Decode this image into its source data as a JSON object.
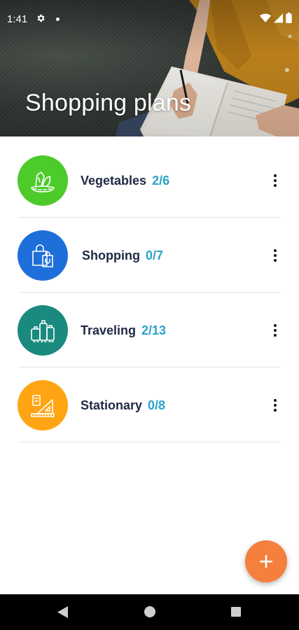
{
  "status_bar": {
    "time": "1:41"
  },
  "header": {
    "title": "Shopping plans"
  },
  "categories": [
    {
      "name": "Vegetables",
      "count": "2/6",
      "color": "#4ccb2a",
      "icon": "vegetables-icon"
    },
    {
      "name": "Shopping",
      "count": "0/7",
      "color": "#1e6fd9",
      "icon": "shopping-bags-icon"
    },
    {
      "name": "Traveling",
      "count": "2/13",
      "color": "#1a8a7e",
      "icon": "luggage-icon"
    },
    {
      "name": "Stationary",
      "count": "0/8",
      "color": "#ffa412",
      "icon": "ruler-triangle-icon"
    }
  ],
  "fab": {
    "label": "+",
    "color": "#f57f3c"
  },
  "colors": {
    "title_text": "#1f2a44",
    "count_text": "#29a3c9"
  }
}
